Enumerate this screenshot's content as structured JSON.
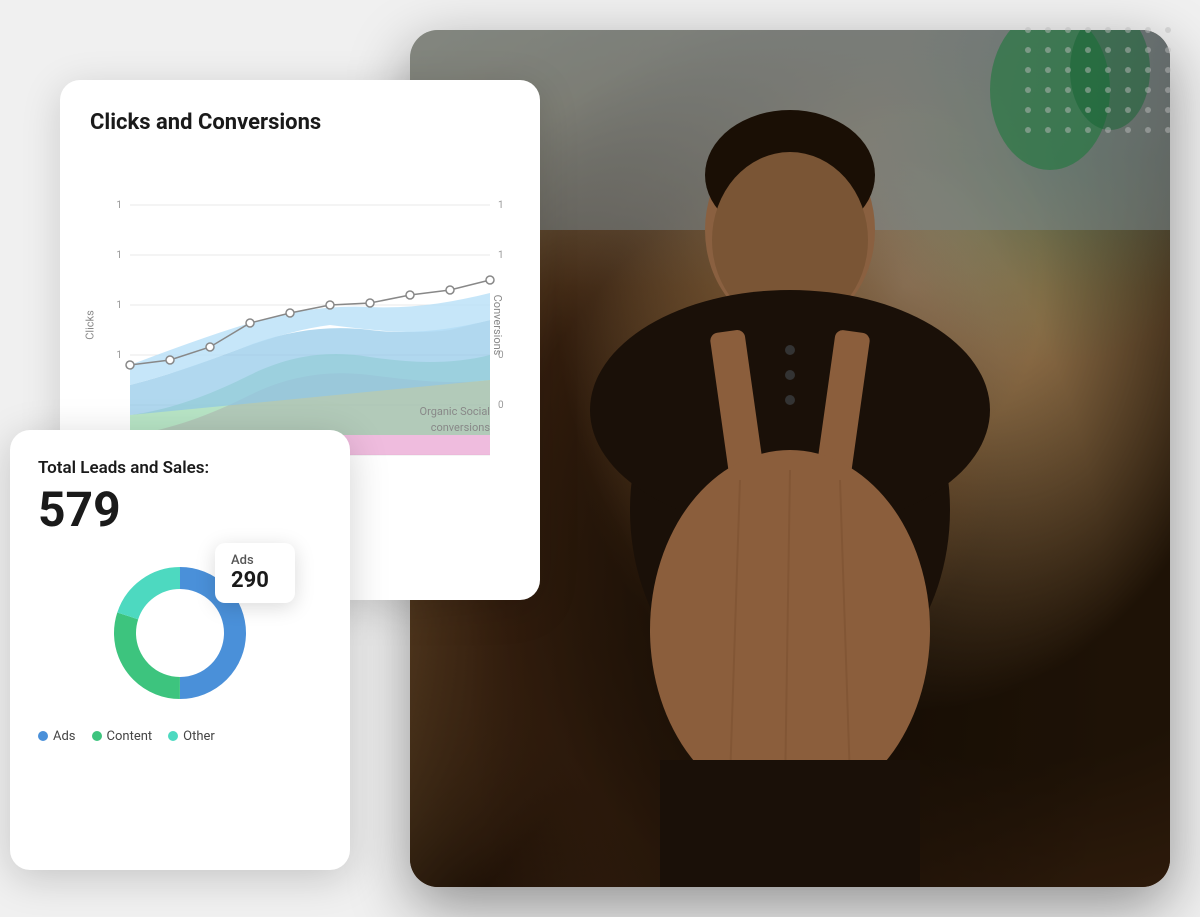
{
  "photo_panel": {
    "alt": "Man in leather apron standing in store"
  },
  "clicks_card": {
    "title": "Clicks and Conversions",
    "y_axis_left": "Clicks",
    "y_axis_right": "Conversions",
    "y_labels": [
      "1",
      "1",
      "1",
      "1"
    ],
    "y_labels_right": [
      "1",
      "1",
      "0",
      "0"
    ],
    "organic_label_line1": "Organic Social",
    "organic_label_line2": "conversions"
  },
  "leads_card": {
    "title": "Total Leads and Sales:",
    "number": "579",
    "tooltip": {
      "label": "Ads",
      "value": "290"
    },
    "legend": [
      {
        "label": "Ads",
        "color": "#4a90d9"
      },
      {
        "label": "Content",
        "color": "#3dc47e"
      },
      {
        "label": "Other",
        "color": "#4dd9c0"
      }
    ],
    "donut": {
      "segments": [
        {
          "label": "Ads",
          "value": 50,
          "color": "#4a90d9"
        },
        {
          "label": "Content",
          "value": 30,
          "color": "#3dc47e"
        },
        {
          "label": "Other",
          "value": 20,
          "color": "#4dd9c0"
        }
      ],
      "total": 100
    }
  },
  "dots": {
    "count": 40
  }
}
